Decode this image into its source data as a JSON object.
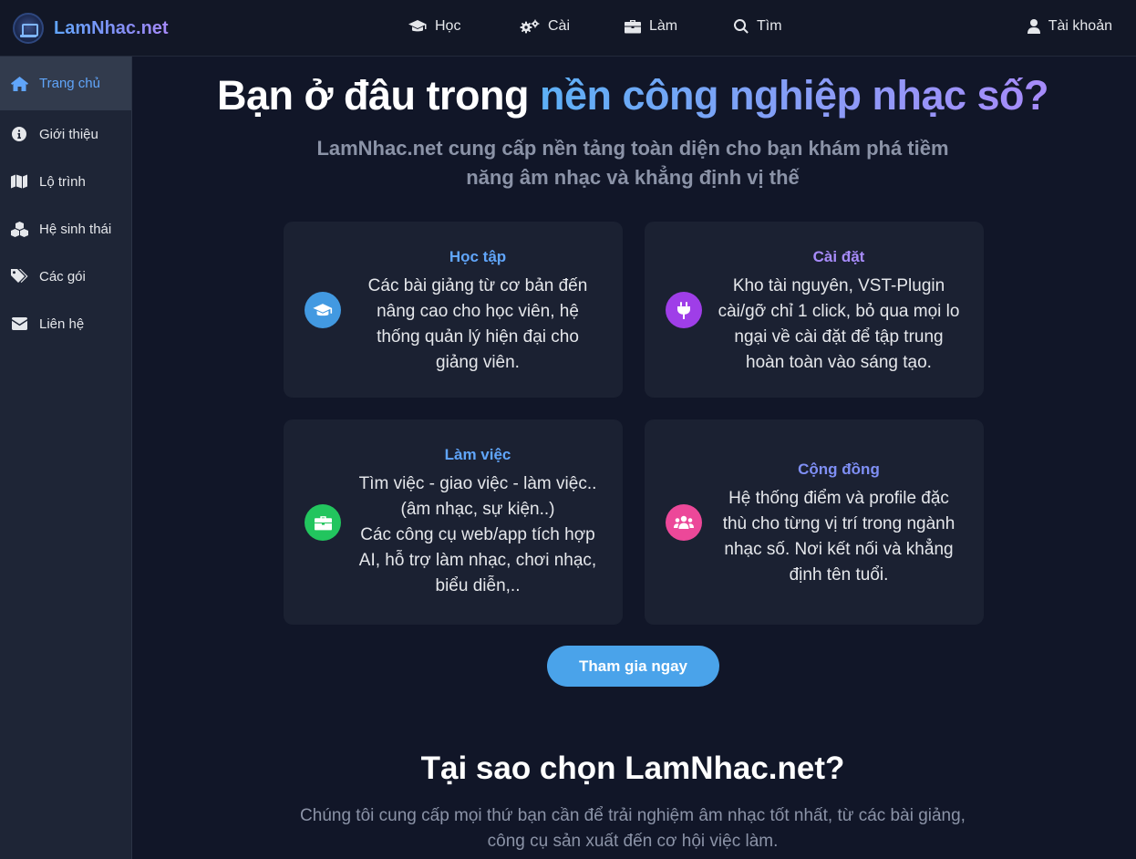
{
  "brand": {
    "name": "LamNhac.net"
  },
  "topnav": [
    {
      "label": "Học",
      "icon": "graduation-cap-icon"
    },
    {
      "label": "Cài",
      "icon": "gears-icon"
    },
    {
      "label": "Làm",
      "icon": "briefcase-icon"
    },
    {
      "label": "Tìm",
      "icon": "search-icon"
    }
  ],
  "account": {
    "label": "Tài khoản",
    "icon": "user-icon"
  },
  "sidebar": {
    "items": [
      {
        "label": "Trang chủ",
        "icon": "home-icon",
        "active": true
      },
      {
        "label": "Giới thiệu",
        "icon": "info-icon"
      },
      {
        "label": "Lộ trình",
        "icon": "map-icon"
      },
      {
        "label": "Hệ sinh thái",
        "icon": "cubes-icon"
      },
      {
        "label": "Các gói",
        "icon": "tags-icon"
      },
      {
        "label": "Liên hệ",
        "icon": "envelope-icon"
      }
    ]
  },
  "hero": {
    "title_plain": "Bạn ở đâu trong ",
    "title_highlight": "nền công nghiệp nhạc số?",
    "subtitle": "LamNhac.net cung cấp nền tảng toàn diện cho bạn khám phá tiềm năng âm nhạc và khẳng định vị thế"
  },
  "cards": [
    {
      "title": "Học tập",
      "title_color": "#60a5fa",
      "icon": "graduation-cap-icon",
      "icon_bg": "#4299e1",
      "desc": "Các bài giảng từ cơ bản đến nâng cao cho học viên, hệ thống quản lý hiện đại cho giảng viên."
    },
    {
      "title": "Cài đặt",
      "title_color": "#a78bfa",
      "icon": "plug-icon",
      "icon_bg": "#9f3ee8",
      "desc": "Kho tài nguyên, VST-Plugin cài/gỡ chỉ 1 click, bỏ qua mọi lo ngại về cài đặt để tập trung hoàn toàn vào sáng tạo."
    },
    {
      "title": "Làm việc",
      "title_color": "#60a5fa",
      "icon": "briefcase-icon",
      "icon_bg": "#22c55e",
      "desc": "Tìm việc - giao việc - làm việc.. (âm nhạc, sự kiện..)",
      "desc2": "Các công cụ web/app tích hợp AI, hỗ trợ làm nhạc, chơi nhạc, biểu diễn,.."
    },
    {
      "title": "Cộng đồng",
      "title_color": "#7f8ff5",
      "icon": "users-icon",
      "icon_bg": "#ec4899",
      "desc": "Hệ thống điểm và profile đặc thù cho từng vị trí trong ngành nhạc số. Nơi kết nối và khẳng định tên tuổi."
    }
  ],
  "cta": {
    "label": "Tham gia ngay"
  },
  "why": {
    "title": "Tại sao chọn LamNhac.net?",
    "subtitle": "Chúng tôi cung cấp mọi thứ bạn cần để trải nghiệm âm nhạc tốt nhất, từ các bài giảng, công cụ sản xuất đến cơ hội việc làm."
  }
}
